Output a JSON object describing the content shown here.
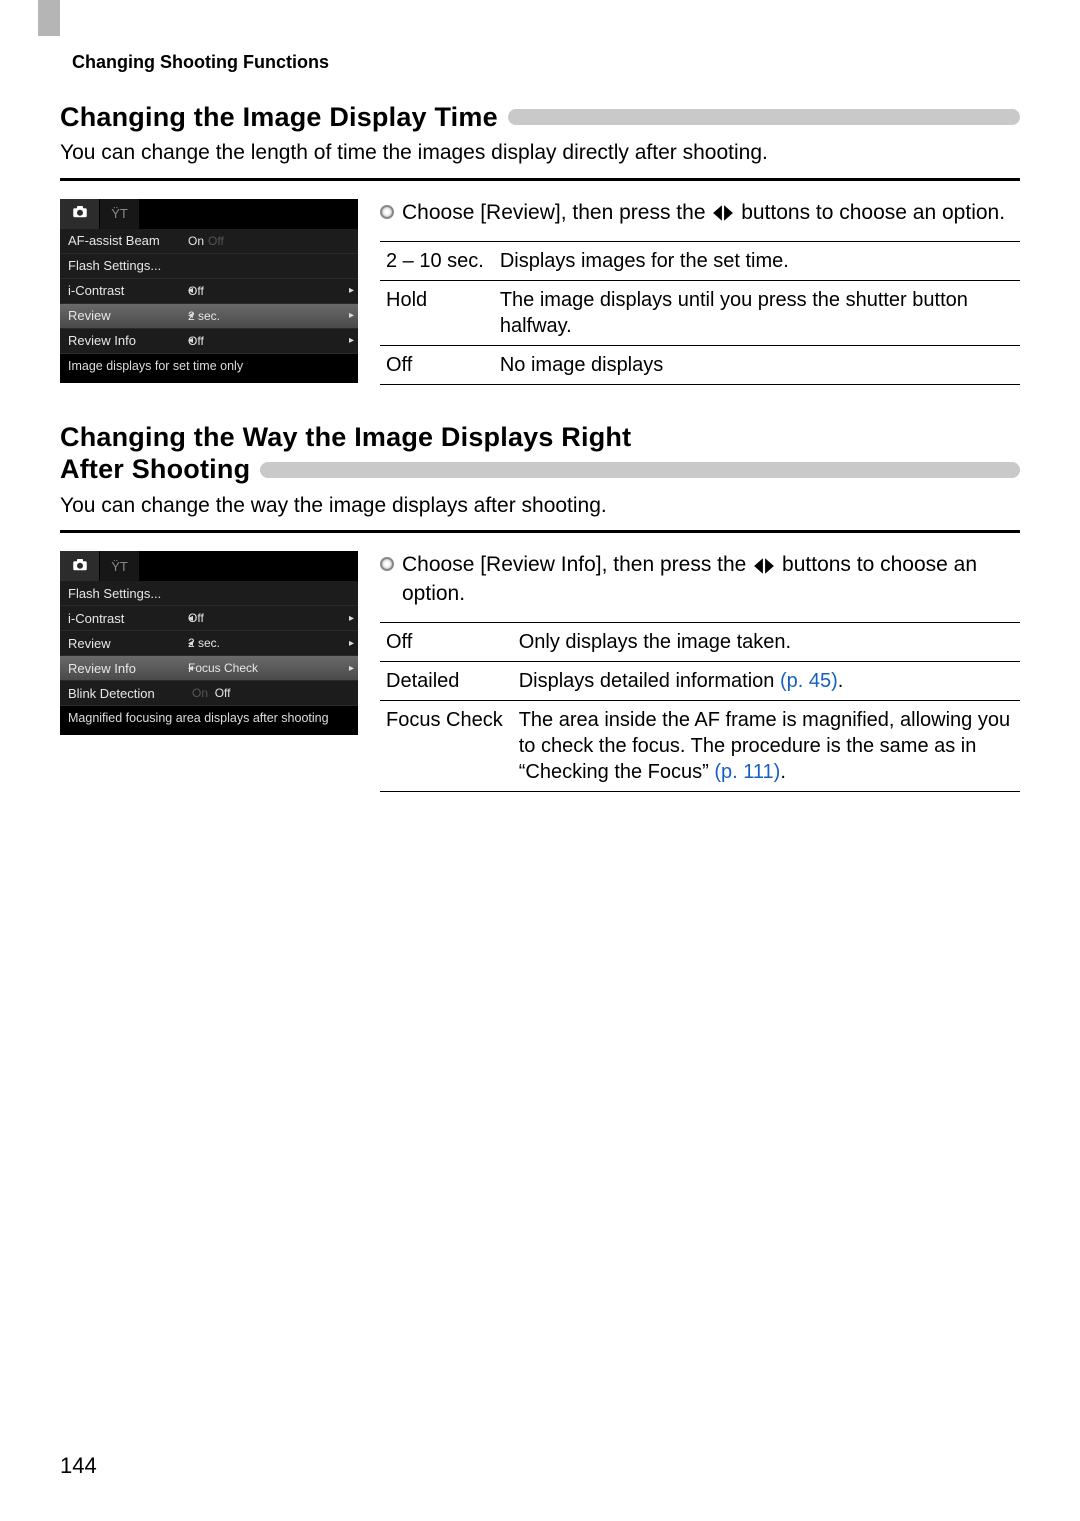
{
  "running_header": "Changing Shooting Functions",
  "page_number": "144",
  "section1": {
    "heading": "Changing the Image Display Time",
    "intro": "You can change the length of time the images display directly after shooting.",
    "instruction_prefix": "Choose [Review], then press the ",
    "instruction_suffix": " buttons to choose an option.",
    "lcd": {
      "tabs": {
        "camera": "camera-icon",
        "tools": "tools-icon"
      },
      "items": [
        {
          "label": "AF-assist Beam",
          "value": "On",
          "value_dim": "Off",
          "selected": false,
          "has_arrows": false
        },
        {
          "label": "Flash Settings...",
          "value": "",
          "selected": false,
          "has_arrows": false
        },
        {
          "label": "i-Contrast",
          "value": "Off",
          "selected": false,
          "has_arrows": true
        },
        {
          "label": "Review",
          "value": "2 sec.",
          "selected": true,
          "has_arrows": true
        },
        {
          "label": "Review Info",
          "value": "Off",
          "selected": false,
          "has_arrows": true
        }
      ],
      "hint": "Image displays for set time only"
    },
    "table": [
      {
        "opt": "2 – 10 sec.",
        "desc": "Displays images for the set time."
      },
      {
        "opt": "Hold",
        "desc": "The image displays until you press the shutter button halfway."
      },
      {
        "opt": "Off",
        "desc": "No image displays"
      }
    ]
  },
  "section2": {
    "heading_line1": "Changing the Way the Image Displays Right",
    "heading_line2": "After Shooting",
    "intro": "You can change the way the image displays after shooting.",
    "instruction_prefix": "Choose [Review Info], then press the ",
    "instruction_suffix": " buttons to choose an option.",
    "lcd": {
      "items": [
        {
          "label": "Flash Settings...",
          "value": "",
          "selected": false,
          "has_arrows": false
        },
        {
          "label": "i-Contrast",
          "value": "Off",
          "selected": false,
          "has_arrows": true
        },
        {
          "label": "Review",
          "value": "2 sec.",
          "selected": false,
          "has_arrows": true
        },
        {
          "label": "Review Info",
          "value": "Focus Check",
          "selected": true,
          "has_arrows": true
        },
        {
          "label": "Blink Detection",
          "value": "Off",
          "value_dim_left": "On",
          "selected": false,
          "has_arrows": false
        }
      ],
      "hint": "Magnified focusing area displays after shooting"
    },
    "table": [
      {
        "opt": "Off",
        "desc": "Only displays the image taken."
      },
      {
        "opt": "Detailed",
        "desc_pre": "Displays detailed information ",
        "pref": "(p. 45)",
        "desc_post": "."
      },
      {
        "opt": "Focus Check",
        "desc_pre": "The area inside the AF frame is magnified, allowing you to check the focus. The procedure is the same as in “Checking the Focus” ",
        "pref": "(p. 111)",
        "desc_post": "."
      }
    ]
  }
}
